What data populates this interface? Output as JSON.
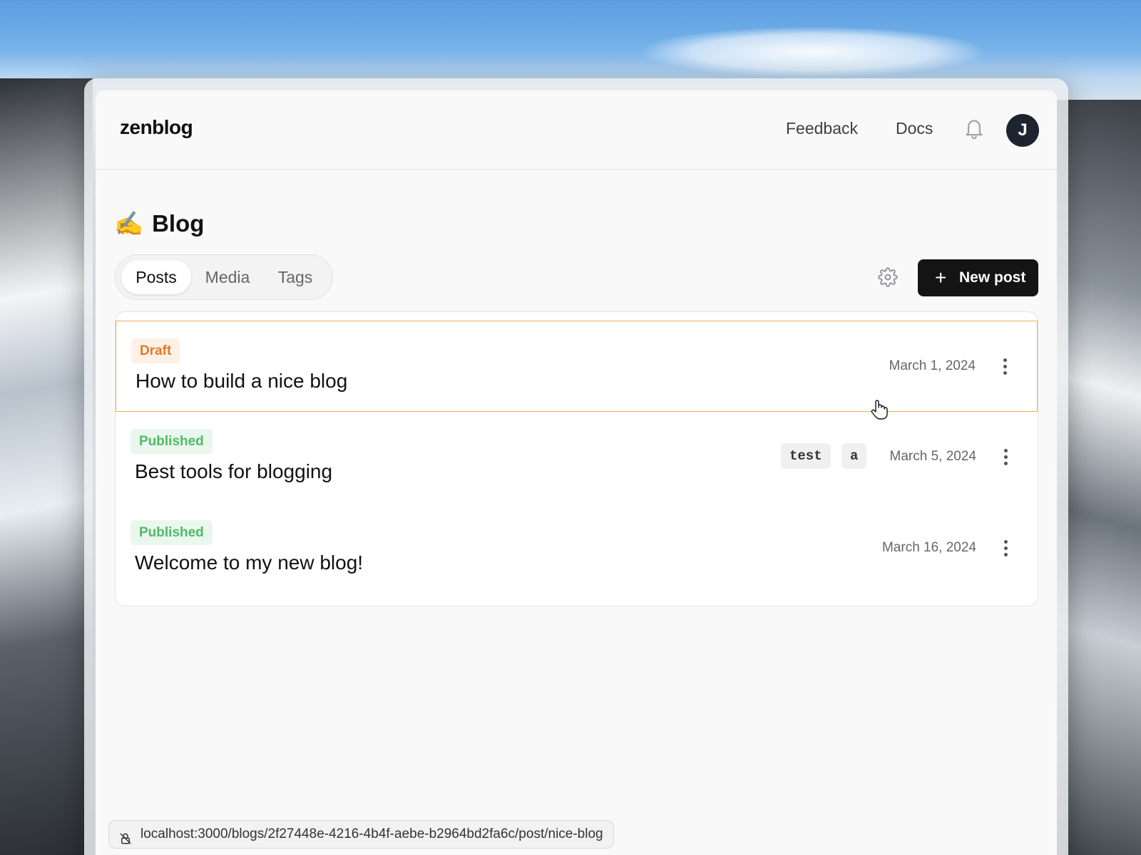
{
  "app": {
    "logo": "zenblog"
  },
  "topbar": {
    "feedback_label": "Feedback",
    "docs_label": "Docs",
    "avatar_initial": "J",
    "bell_icon": "bell-icon"
  },
  "page": {
    "emoji": "✍️",
    "title": "Blog"
  },
  "tabs": [
    {
      "label": "Posts",
      "active": true
    },
    {
      "label": "Media",
      "active": false
    },
    {
      "label": "Tags",
      "active": false
    }
  ],
  "toolbar": {
    "settings_icon": "gear-icon",
    "new_post_icon": "plus-icon",
    "new_post_label": "New post"
  },
  "posts": [
    {
      "status": "Draft",
      "title": "How to build a nice blog",
      "tags": [],
      "date": "March 1, 2024",
      "highlighted": true
    },
    {
      "status": "Published",
      "title": "Best tools for blogging",
      "tags": [
        "test",
        "a"
      ],
      "date": "March 5, 2024",
      "highlighted": false
    },
    {
      "status": "Published",
      "title": "Welcome to my new blog!",
      "tags": [],
      "date": "March 16, 2024",
      "highlighted": false
    }
  ],
  "status_bar": {
    "url": "localhost:3000/blogs/2f27448e-4216-4b4f-aebe-b2964bd2fa6c/post/nice-blog"
  },
  "colors": {
    "draft_badge_text": "#e07a2b",
    "draft_badge_bg": "#fdf1e6",
    "published_badge_text": "#4fba67",
    "published_badge_bg": "#eaf7ec",
    "highlight_border": "#f3a95a",
    "primary_button": "#141414",
    "avatar_bg": "#1d2430"
  }
}
